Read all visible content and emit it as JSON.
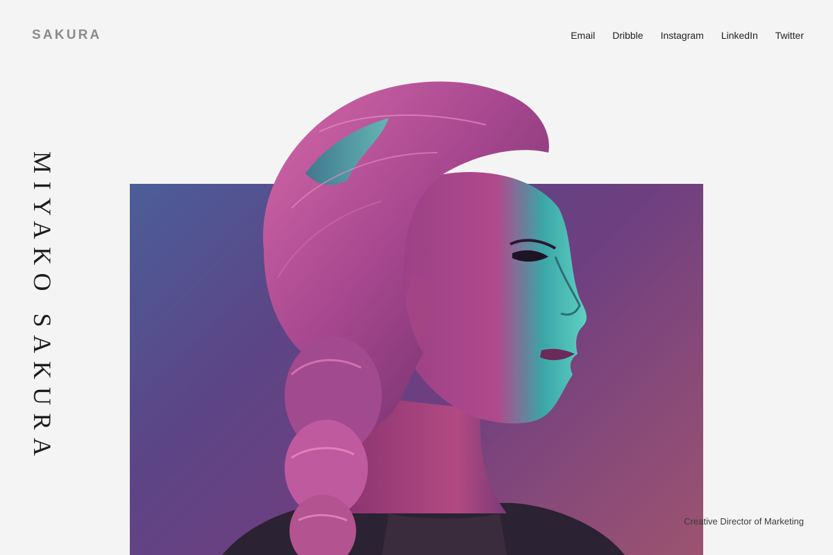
{
  "header": {
    "logo": "SAKURA",
    "nav": [
      "Email",
      "Dribble",
      "Instagram",
      "LinkedIn",
      "Twitter"
    ]
  },
  "hero": {
    "name": "MIYAKO SAKURA",
    "role": "Creative Director of Marketing",
    "gradient_colors": [
      "#4b5e99",
      "#6e3f80",
      "#9d546f"
    ],
    "portrait_tint": {
      "highlight": "#2fb8ad",
      "hair": "#c0508f",
      "shadow": "#3a1a3e"
    }
  }
}
